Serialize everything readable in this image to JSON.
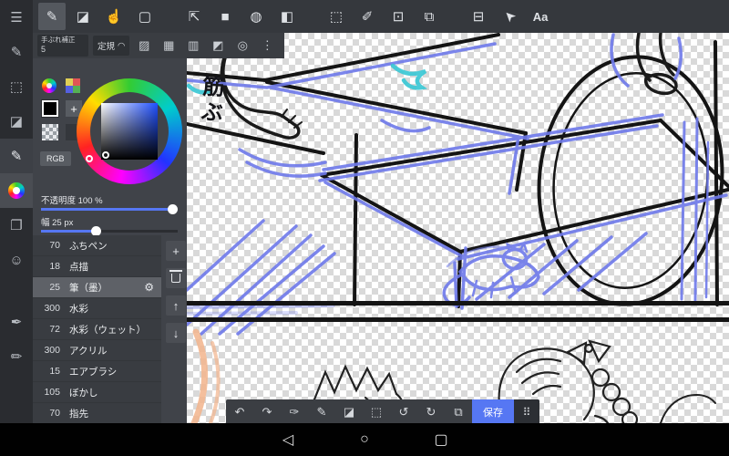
{
  "colors": {
    "accent": "#5677f3",
    "toolbar": "#35383d",
    "panel": "#404349",
    "sketch_blue": "#6e79ea",
    "sketch_teal": "#36c6d4",
    "sketch_orange": "#f2b48c"
  },
  "topbar": {
    "tools": [
      {
        "name": "pen-tool",
        "glyph": "✎"
      },
      {
        "name": "eraser-tool",
        "glyph": "◪"
      },
      {
        "name": "hand-tool",
        "glyph": "☝"
      },
      {
        "name": "shape-tool",
        "glyph": "▢"
      },
      {
        "name": "move-tool",
        "glyph": "⇱"
      },
      {
        "name": "fill-rect-tool",
        "glyph": "■"
      },
      {
        "name": "bucket-tool",
        "glyph": "◍"
      },
      {
        "name": "gradient-tool",
        "glyph": "◧"
      },
      {
        "name": "select-tool",
        "glyph": "⬚"
      },
      {
        "name": "select-pen-tool",
        "glyph": "✐"
      },
      {
        "name": "select-edit-tool",
        "glyph": "⊡"
      },
      {
        "name": "select-move-tool",
        "glyph": "⧉"
      },
      {
        "name": "panel-divide-tool",
        "glyph": "⊟"
      },
      {
        "name": "operation-tool",
        "glyph": "➤"
      },
      {
        "name": "text-tool",
        "glyph": "Aa"
      }
    ]
  },
  "toolbar2": {
    "stabilizer_label": "手ぶれ補正",
    "stabilizer_value": "5",
    "ruler_label": "定規",
    "ruler_glyph": "◠",
    "icons": [
      {
        "name": "tone-diagonal",
        "glyph": "▨"
      },
      {
        "name": "tone-grid",
        "glyph": "▦"
      },
      {
        "name": "tone-lines",
        "glyph": "▥"
      },
      {
        "name": "tone-half",
        "glyph": "◩"
      },
      {
        "name": "tone-circle",
        "glyph": "◎"
      }
    ],
    "overflow_glyph": "⋮"
  },
  "sidebar": {
    "items": [
      {
        "name": "menu",
        "glyph": "☰"
      },
      {
        "name": "edit",
        "glyph": "✎"
      },
      {
        "name": "select",
        "glyph": "⬚"
      },
      {
        "name": "eraser",
        "glyph": "◪"
      },
      {
        "name": "pen",
        "glyph": "✎"
      },
      {
        "name": "palette",
        "glyph": ""
      },
      {
        "name": "layers",
        "glyph": "❐"
      },
      {
        "name": "sticker",
        "glyph": "☺"
      },
      {
        "name": "stylus",
        "glyph": "✒"
      },
      {
        "name": "brush",
        "glyph": "✏"
      }
    ]
  },
  "color_panel": {
    "rgb_label": "RGB",
    "plus_label": "+",
    "opacity_label": "不透明度 100 %",
    "width_label": "幅 25 px"
  },
  "brushes": {
    "gear_glyph": "⚙",
    "add_label": "+",
    "up_label": "↑",
    "down_label": "↓",
    "rows": [
      {
        "size": "70",
        "name": "ふちペン"
      },
      {
        "size": "18",
        "name": "点描"
      },
      {
        "size": "25",
        "name": "筆（墨）"
      },
      {
        "size": "300",
        "name": "水彩"
      },
      {
        "size": "72",
        "name": "水彩（ウェット）"
      },
      {
        "size": "300",
        "name": "アクリル"
      },
      {
        "size": "15",
        "name": "エアブラシ"
      },
      {
        "size": "105",
        "name": "ぼかし"
      },
      {
        "size": "70",
        "name": "指先"
      }
    ]
  },
  "canvas": {
    "handwriting": "筋ぶ"
  },
  "bottom_toolbar": {
    "icons": [
      {
        "name": "undo",
        "glyph": "↶"
      },
      {
        "name": "redo",
        "glyph": "↷"
      },
      {
        "name": "eyedropper",
        "glyph": "✑"
      },
      {
        "name": "pen",
        "glyph": "✎"
      },
      {
        "name": "eraser",
        "glyph": "◪"
      },
      {
        "name": "deselect",
        "glyph": "⬚"
      },
      {
        "name": "rotate-ccw",
        "glyph": "↺"
      },
      {
        "name": "rotate-cw",
        "glyph": "↻"
      },
      {
        "name": "export",
        "glyph": "⧉"
      }
    ],
    "save_label": "保存",
    "grid_glyph": "⠿"
  },
  "android_nav": {
    "back": "◁",
    "home": "○",
    "recents": "▢"
  }
}
